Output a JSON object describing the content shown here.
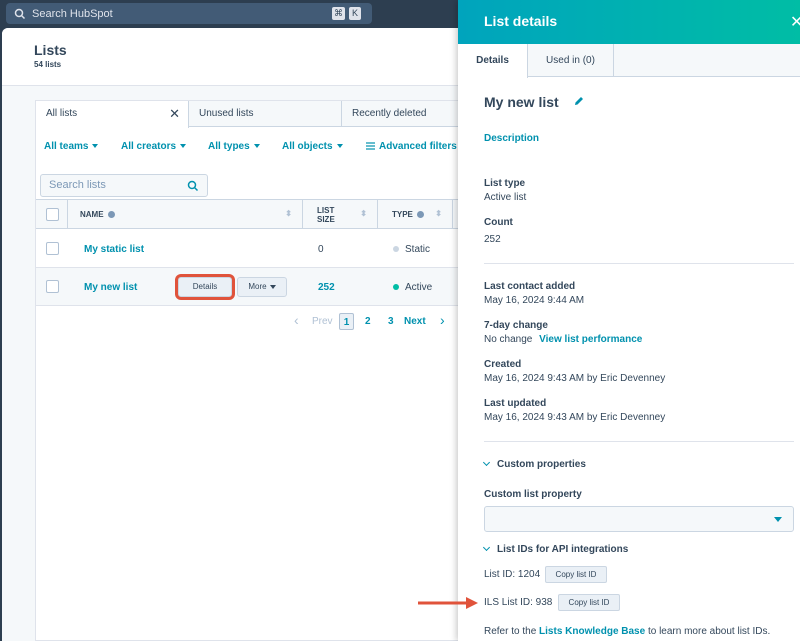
{
  "topbar": {
    "search_placeholder": "Search HubSpot",
    "shortcut_mod": "⌘",
    "shortcut_key": "K"
  },
  "page": {
    "title": "Lists",
    "subtitle": "54 lists"
  },
  "tabs": [
    {
      "label": "All lists",
      "active": true,
      "close": "✕"
    },
    {
      "label": "Unused lists"
    },
    {
      "label": "Recently deleted"
    }
  ],
  "filters": [
    "All teams",
    "All creators",
    "All types",
    "All objects",
    "Advanced filters"
  ],
  "list_search": {
    "placeholder": "Search lists"
  },
  "table": {
    "headers": {
      "name": "NAME",
      "size_line1": "LIST",
      "size_line2": "SIZE",
      "type": "TYPE"
    },
    "rows": [
      {
        "name": "My static list",
        "size": "0",
        "type": "Static",
        "type_color": "#cbd6e2"
      },
      {
        "name": "My new list",
        "size": "252",
        "type": "Active",
        "type_color": "#00bda5",
        "details_label": "Details",
        "more_label": "More"
      }
    ]
  },
  "pager": {
    "prev": "Prev",
    "pages": [
      "1",
      "2",
      "3"
    ],
    "next": "Next"
  },
  "panel": {
    "title": "List details",
    "close": "✕",
    "tabs": [
      "Details",
      "Used in (0)"
    ],
    "list_name": "My new list",
    "description_label": "Description",
    "list_type_label": "List type",
    "list_type_value": "Active list",
    "count_label": "Count",
    "count_value": "252",
    "last_contact_label": "Last contact added",
    "last_contact_value": "May 16, 2024 9:44 AM",
    "seven_day_label": "7-day change",
    "seven_day_value": "No change",
    "view_performance": "View list performance",
    "created_label": "Created",
    "created_value": "May 16, 2024 9:43 AM by Eric Devenney",
    "updated_label": "Last updated",
    "updated_value": "May 16, 2024 9:43 AM by Eric Devenney",
    "custom_props_section": "Custom properties",
    "custom_list_prop_label": "Custom list property",
    "api_section": "List IDs for API integrations",
    "list_id": "List ID: 1204",
    "copy_list_id": "Copy list ID",
    "ils_list_id": "ILS List ID: 938",
    "copy_ils_id": "Copy list ID",
    "refer_prefix": "Refer to the",
    "kb_link": "Lists Knowledge Base",
    "refer_suffix": "to learn more about list IDs."
  },
  "colors": {
    "accent": "#0091ae",
    "header_gradient_start": "#00a4bd",
    "header_gradient_end": "#00bda5",
    "highlight": "#e0533b"
  }
}
